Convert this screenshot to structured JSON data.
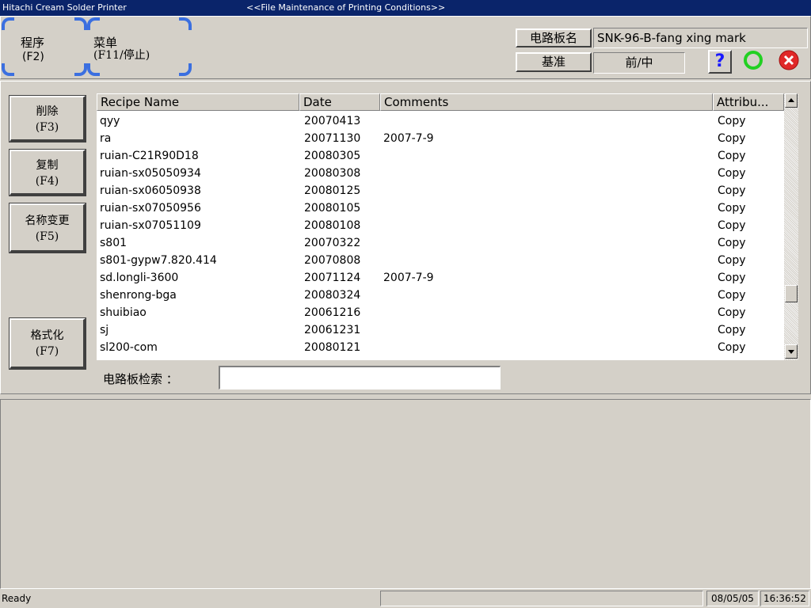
{
  "window": {
    "app_title": "Hitachi Cream Solder Printer",
    "screen_title": "<<File Maintenance of Printing Conditions>>"
  },
  "toolbar": {
    "program_label": "程序",
    "program_key": "(F2)",
    "menu_label": "菜单",
    "menu_key": "(F11/停止)"
  },
  "board": {
    "name_label": "电路板名",
    "name_value": "SNK-96-B-fang xing mark",
    "ref_label": "基准",
    "ref_value": "前/中"
  },
  "actions": {
    "delete_label": "削除",
    "delete_key": "(F3)",
    "copy_label": "复制",
    "copy_key": "(F4)",
    "rename_label": "名称变更",
    "rename_key": "(F5)",
    "format_label": "格式化",
    "format_key": "(F7)"
  },
  "table": {
    "columns": [
      "Recipe Name",
      "Date",
      "Comments",
      "Attribu..."
    ],
    "rows": [
      {
        "name": "qyy",
        "date": "20070413",
        "comment": "",
        "attr": "Copy"
      },
      {
        "name": "ra",
        "date": "20071130",
        "comment": "2007-7-9",
        "attr": "Copy"
      },
      {
        "name": "ruian-C21R90D18",
        "date": "20080305",
        "comment": "",
        "attr": "Copy"
      },
      {
        "name": "ruian-sx05050934",
        "date": "20080308",
        "comment": "",
        "attr": "Copy"
      },
      {
        "name": "ruian-sx06050938",
        "date": "20080125",
        "comment": "",
        "attr": "Copy"
      },
      {
        "name": "ruian-sx07050956",
        "date": "20080105",
        "comment": "",
        "attr": "Copy"
      },
      {
        "name": "ruian-sx07051109",
        "date": "20080108",
        "comment": "",
        "attr": "Copy"
      },
      {
        "name": "s801",
        "date": "20070322",
        "comment": "",
        "attr": "Copy"
      },
      {
        "name": "s801-gypw7.820.414",
        "date": "20070808",
        "comment": "",
        "attr": "Copy"
      },
      {
        "name": "sd.longli-3600",
        "date": "20071124",
        "comment": "2007-7-9",
        "attr": "Copy"
      },
      {
        "name": "shenrong-bga",
        "date": "20080324",
        "comment": "",
        "attr": "Copy"
      },
      {
        "name": "shuibiao",
        "date": "20061216",
        "comment": "",
        "attr": "Copy"
      },
      {
        "name": "sj",
        "date": "20061231",
        "comment": "",
        "attr": "Copy"
      },
      {
        "name": "sl200-com",
        "date": "20080121",
        "comment": "",
        "attr": "Copy"
      }
    ]
  },
  "search": {
    "label": "电路板检索 ：",
    "value": ""
  },
  "status": {
    "text": "Ready",
    "date": "08/05/05",
    "time": "16:36:52"
  },
  "icons": {
    "help": "help-icon",
    "ok": "ok-circle-icon",
    "cancel": "cancel-icon"
  },
  "colors": {
    "titlebar": "#0a246a",
    "corner_accent": "#3b6fe0",
    "ok_green": "#22d022",
    "cancel_red": "#e02828"
  }
}
